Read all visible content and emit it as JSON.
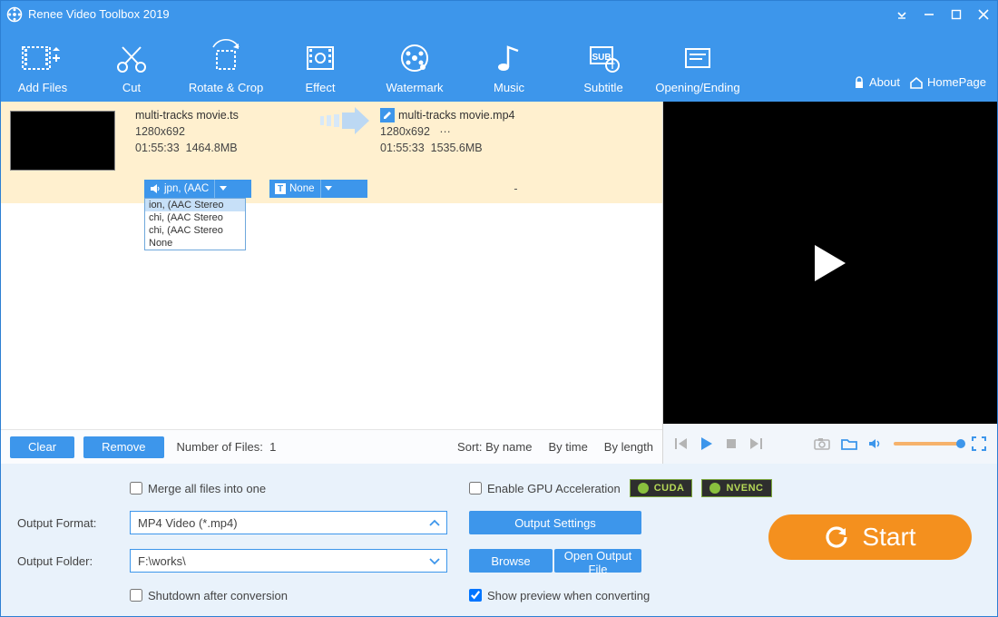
{
  "app": {
    "title": "Renee Video Toolbox 2019",
    "links": {
      "about": "About",
      "homepage": "HomePage"
    }
  },
  "toolbar": {
    "add_files": "Add Files",
    "cut": "Cut",
    "rotate_crop": "Rotate & Crop",
    "effect": "Effect",
    "watermark": "Watermark",
    "music": "Music",
    "subtitle": "Subtitle",
    "opening_ending": "Opening/Ending"
  },
  "file": {
    "src": {
      "name": "multi-tracks movie.ts",
      "resolution": "1280x692",
      "duration": "01:55:33",
      "size": "1464.8MB"
    },
    "dst": {
      "name": "multi-tracks movie.mp4",
      "resolution": "1280x692",
      "extra": "···",
      "duration": "01:55:33",
      "size": "1535.6MB"
    },
    "audio_dd": "jpn,       (AAC",
    "sub_dd": "None",
    "dash": "-",
    "audio_options": [
      "ion,            (AAC Stereo",
      "chi,            (AAC Stereo",
      "chi,            (AAC Stereo",
      "None"
    ]
  },
  "listbar": {
    "clear": "Clear",
    "remove": "Remove",
    "files_label": "Number of Files:",
    "files_count": "1",
    "sort": "Sort:",
    "by_name": "By name",
    "by_time": "By time",
    "by_length": "By length"
  },
  "settings": {
    "merge": "Merge all files into one",
    "gpu": "Enable GPU Acceleration",
    "cuda": "CUDA",
    "nvenc": "NVENC",
    "output_format_label": "Output Format:",
    "output_format_value": "MP4 Video (*.mp4)",
    "output_settings": "Output Settings",
    "output_folder_label": "Output Folder:",
    "output_folder_value": "F:\\works\\",
    "browse": "Browse",
    "open_output": "Open Output File",
    "shutdown": "Shutdown after conversion",
    "show_preview": "Show preview when converting",
    "start": "Start"
  }
}
